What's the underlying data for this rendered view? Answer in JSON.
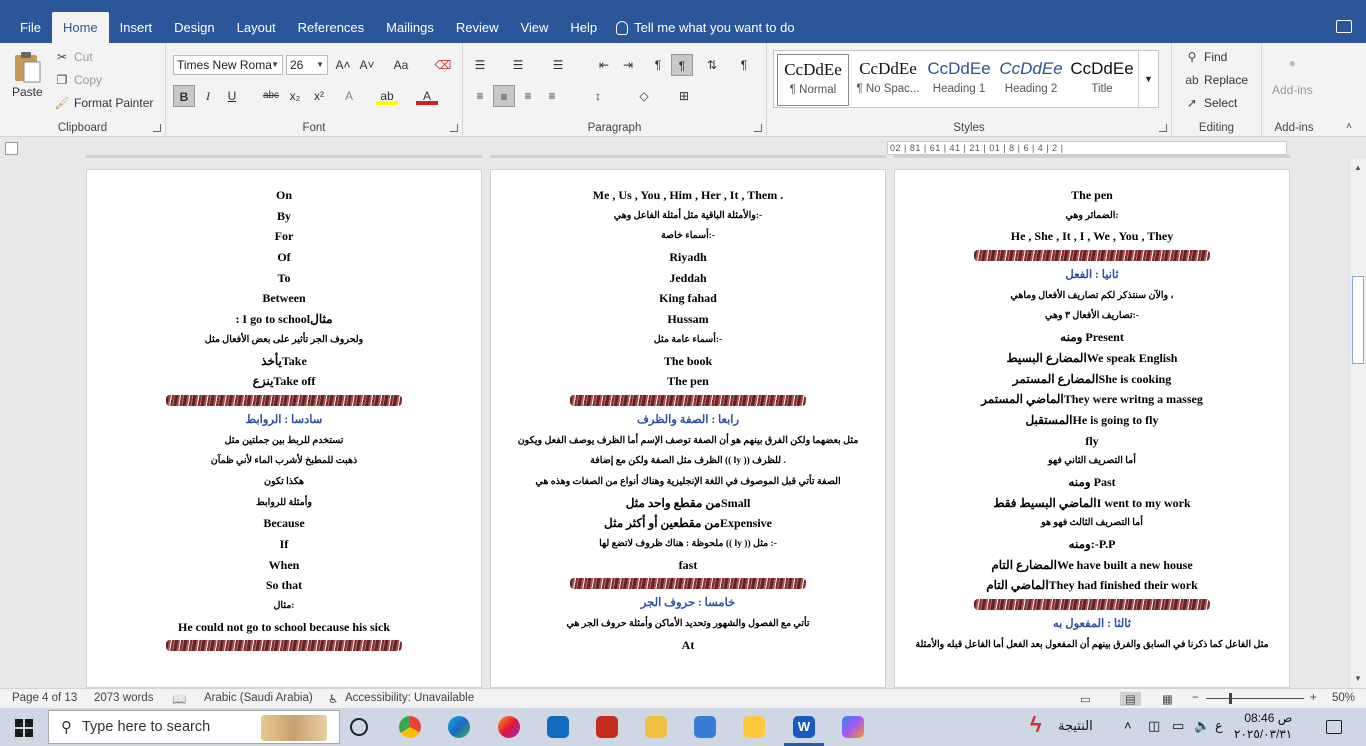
{
  "ribbon_tabs": [
    "File",
    "Home",
    "Insert",
    "Design",
    "Layout",
    "References",
    "Mailings",
    "Review",
    "View",
    "Help"
  ],
  "tell_me": "Tell me what you want to do",
  "clipboard": {
    "paste": "Paste",
    "cut": "Cut",
    "copy": "Copy",
    "format_painter": "Format Painter",
    "label": "Clipboard"
  },
  "font": {
    "name": "Times New Roma",
    "size": "26",
    "label": "Font",
    "bold": "B",
    "italic": "I",
    "underline": "U",
    "strike": "abc",
    "sub": "x₂",
    "sup": "x²",
    "grow": "A˄",
    "shrink": "A˅",
    "case": "Aa"
  },
  "paragraph": {
    "label": "Paragraph"
  },
  "styles": {
    "label": "Styles",
    "items": [
      {
        "preview": "CcDdEe",
        "name": "¶ Normal"
      },
      {
        "preview": "CcDdEe",
        "name": "¶ No Spac..."
      },
      {
        "preview": "CcDdEe",
        "name": "Heading 1"
      },
      {
        "preview": "CcDdEe",
        "name": "Heading 2"
      },
      {
        "preview": "CcDdEe",
        "name": "Title"
      }
    ]
  },
  "editing": {
    "find": "Find",
    "replace": "Replace",
    "select": "Select",
    "label": "Editing"
  },
  "addins": {
    "btn": "Add-ins",
    "label": "Add-ins"
  },
  "ruler_text": "02 | 81 | 61 | 41 | 21 | 01 | 8 | 6 | 4 | 2 |",
  "pages": [
    {
      "lines": [
        {
          "t": "On"
        },
        {
          "t": "By"
        },
        {
          "t": "For"
        },
        {
          "t": "Of"
        },
        {
          "t": "To"
        },
        {
          "t": "Between"
        },
        {
          "t": ": I go to schoolمثال"
        },
        {
          "t": "ولحروف الجر تأثير على بعض الأفعال مثل",
          "ar": true
        },
        {
          "t": "يأخذTake"
        },
        {
          "t": "ينزعTake off"
        },
        {
          "div": true
        },
        {
          "t": "سادسا : الروابط",
          "hd": true
        },
        {
          "t": "تستخدم للربط بين جملتين مثل",
          "ar": true
        },
        {
          "t": "ذهبت للمطبخ لأشرب الماء لأني ظمآن",
          "ar": true
        },
        {
          "t": "هكذا تكون",
          "ar": true
        },
        {
          "t": "وأمثلة للروابط",
          "ar": true
        },
        {
          "t": "Because"
        },
        {
          "t": "If"
        },
        {
          "t": "When"
        },
        {
          "t": "So that"
        },
        {
          "t": "مثال:",
          "ar": true
        },
        {
          "t": "He could not go to school because his sick"
        },
        {
          "div": true
        }
      ]
    },
    {
      "lines": [
        {
          "t": "Me , Us , You , Him , Her , It , Them ."
        },
        {
          "t": "والأمثلة الباقية مثل أمثلة الفاعل وهي:-",
          "ar": true
        },
        {
          "t": "أسماء خاصة:-",
          "ar": true
        },
        {
          "t": "Riyadh"
        },
        {
          "t": "Jeddah"
        },
        {
          "t": "King fahad"
        },
        {
          "t": "Hussam"
        },
        {
          "t": "أسماء عامة مثل:-",
          "ar": true
        },
        {
          "t": "The book"
        },
        {
          "t": "The pen"
        },
        {
          "div": true
        },
        {
          "t": "رابعا : الصفة والظرف",
          "hd": true
        },
        {
          "t": "مثل بعضهما ولكن الفرق بينهم هو أن الصفة توصف الإسم أما الظرف يوصف الفعل ويكون",
          "ar": true
        },
        {
          "t": "الظرف مثل الصفة ولكن مع إضافة (( ly )) للظرف .",
          "ar": true
        },
        {
          "t": "الصفة تأتي قبل الموصوف في اللغة الإنجليزية وهناك أنواع من الصفات وهذه هي",
          "ar": true
        },
        {
          "t": "من مقطع واحد مثلSmall"
        },
        {
          "t": "من مقطعين أو أكثر مثلExpensive"
        },
        {
          "t": "ملحوظة : هناك ظروف لاتضع لها (( ly )) مثل :-",
          "ar": true
        },
        {
          "t": "fast"
        },
        {
          "div": true
        },
        {
          "t": "خامسا : حروف الجر",
          "hd": true
        },
        {
          "t": "تأتي مع الفصول والشهور وتحديد الأماكن وأمثلة حروف الجر هي",
          "ar": true
        },
        {
          "t": "At"
        }
      ]
    },
    {
      "lines": [
        {
          "t": "The pen"
        },
        {
          "t": "الضمائر وهي:",
          "ar": true
        },
        {
          "t": "He , She , It , I , We , You , They"
        },
        {
          "div": true
        },
        {
          "t": "ثانيا : الفعل",
          "hd": true
        },
        {
          "t": "والآن سنتذكر لكم تصاريف الأفعال وماهي ،",
          "ar": true
        },
        {
          "t": "تصاريف الأفعال ٣ وهي:-",
          "ar": true
        },
        {
          "t": "ومنه Present"
        },
        {
          "t": "المضارع البسيطWe speak English"
        },
        {
          "t": "المضارع المستمرShe is cooking"
        },
        {
          "t": "الماضي المستمرThey were writng a masseg"
        },
        {
          "t": "المستقبلHe is going to fly"
        },
        {
          "t": "fly"
        },
        {
          "t": "أما التصريف الثاني فهو",
          "ar": true
        },
        {
          "t": "ومنه Past"
        },
        {
          "t": "الماضي البسيط فقطI went to my work"
        },
        {
          "t": "أما التصريف الثالث فهو هو",
          "ar": true
        },
        {
          "t": "ومنه:-P.P"
        },
        {
          "t": "المضارع التامWe have built a new house"
        },
        {
          "t": "الماضي التامThey had finished their work"
        },
        {
          "div": true
        },
        {
          "t": "ثالثا : المفعول به",
          "hd": true
        },
        {
          "t": "مثل الفاعل كما ذكرنا في السابق والفرق بينهم أن المفعول بعد الفعل أما الفاعل قبله والأمثلة",
          "ar": true
        }
      ]
    }
  ],
  "status": {
    "page": "Page 4 of 13",
    "words": "2073 words",
    "language": "Arabic (Saudi Arabia)",
    "accessibility": "Accessibility: Unavailable",
    "zoom": "50%",
    "minus": "−",
    "plus": "+"
  },
  "taskbar": {
    "search_placeholder": "Type here to search",
    "result_label": "النتيجة",
    "ime": "ع",
    "time": "08:46 ص",
    "date": "٢٠٢٥/٠٣/٣١"
  },
  "colors": {
    "accent": "#2b579a",
    "heading_blue": "#2f4fa8"
  }
}
